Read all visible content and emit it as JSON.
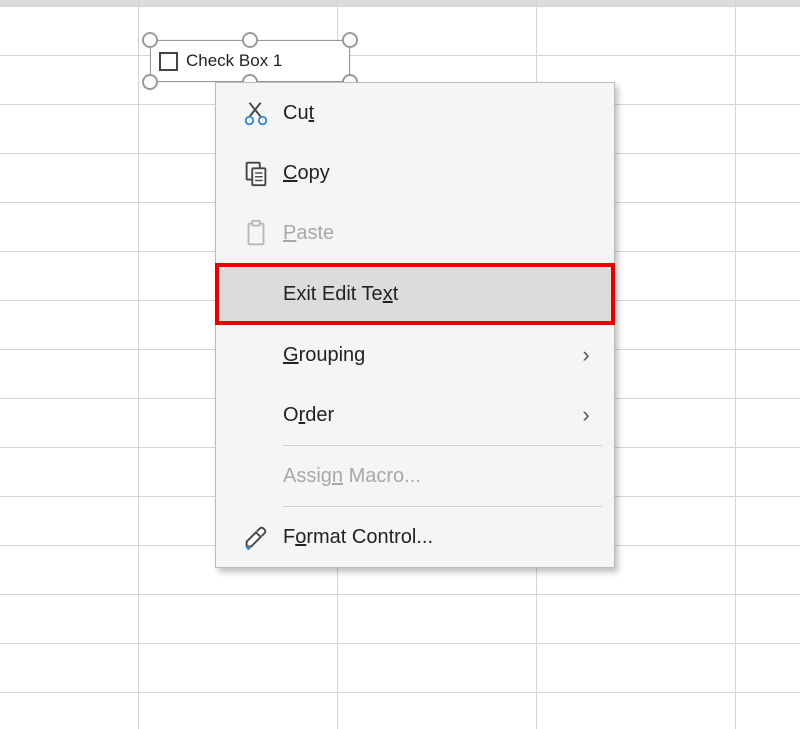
{
  "checkbox": {
    "label": "Check Box 1"
  },
  "menu": {
    "cut": {
      "pre": "Cu",
      "u": "t",
      "post": ""
    },
    "copy": {
      "pre": "",
      "u": "C",
      "post": "opy"
    },
    "paste": {
      "pre": "",
      "u": "P",
      "post": "aste"
    },
    "exit_edit": {
      "pre": "Exit Edit Te",
      "u": "x",
      "post": "t"
    },
    "grouping": {
      "pre": "",
      "u": "G",
      "post": "rouping"
    },
    "order": {
      "pre": "O",
      "u": "r",
      "post": "der"
    },
    "assign_macro": {
      "pre": "Assig",
      "u": "n",
      "post": " Macro..."
    },
    "format": {
      "pre": "F",
      "u": "o",
      "post": "rmat Control..."
    }
  }
}
